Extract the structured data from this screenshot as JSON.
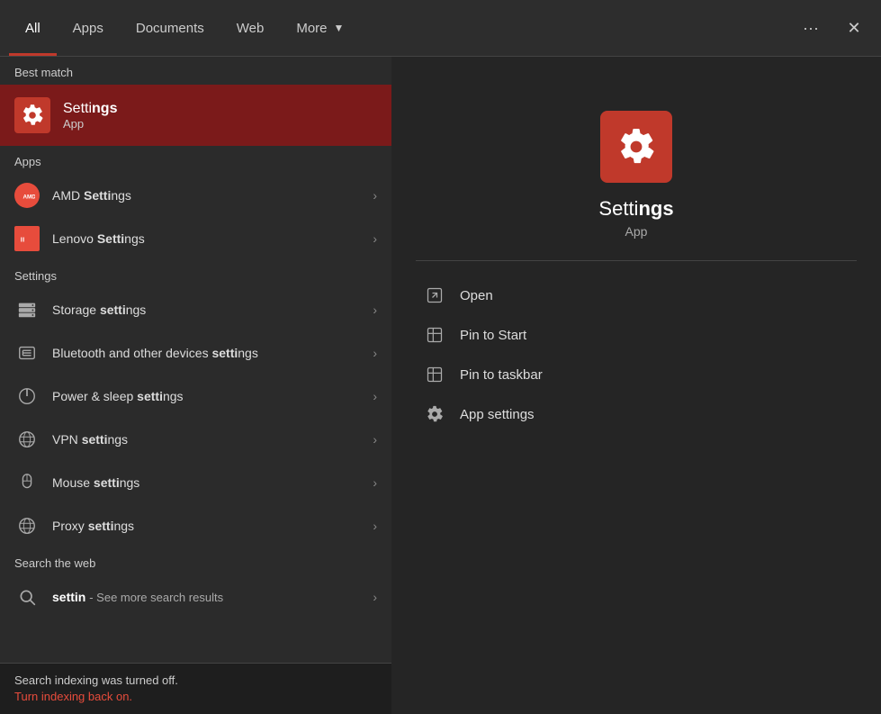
{
  "tabs": [
    {
      "id": "all",
      "label": "All",
      "active": true
    },
    {
      "id": "apps",
      "label": "Apps",
      "active": false
    },
    {
      "id": "documents",
      "label": "Documents",
      "active": false
    },
    {
      "id": "web",
      "label": "Web",
      "active": false
    },
    {
      "id": "more",
      "label": "More",
      "active": false,
      "has_dropdown": true
    }
  ],
  "actions": {
    "more_dots": "···",
    "close": "✕"
  },
  "best_match": {
    "section_label": "Best match",
    "title_prefix": "Setti",
    "title_bold": "ngs",
    "subtitle": "App"
  },
  "apps_section": {
    "label": "Apps",
    "items": [
      {
        "id": "amd",
        "prefix": "AMD ",
        "bold": "Setti",
        "suffix": "ngs"
      },
      {
        "id": "lenovo",
        "prefix": "Lenovo ",
        "bold": "Setti",
        "suffix": "ngs"
      }
    ]
  },
  "settings_section": {
    "label": "Settings",
    "items": [
      {
        "id": "storage",
        "prefix": "Storage ",
        "bold": "setti",
        "suffix": "ngs"
      },
      {
        "id": "bluetooth",
        "prefix": "Bluetooth and other devices ",
        "bold": "setti",
        "suffix": "ngs"
      },
      {
        "id": "power",
        "prefix": "Power & sleep ",
        "bold": "setti",
        "suffix": "ngs"
      },
      {
        "id": "vpn",
        "prefix": "VPN ",
        "bold": "setti",
        "suffix": "ngs"
      },
      {
        "id": "mouse",
        "prefix": "Mouse ",
        "bold": "setti",
        "suffix": "ngs"
      },
      {
        "id": "proxy",
        "prefix": "Proxy ",
        "bold": "setti",
        "suffix": "ngs"
      }
    ]
  },
  "search_web": {
    "label": "Search the web",
    "query": "settin",
    "sub_text": "- See more search results"
  },
  "bottom_bar": {
    "text": "Search indexing was turned off.",
    "link": "Turn indexing back on."
  },
  "right_panel": {
    "app_name_prefix": "Setti",
    "app_name_bold": "ngs",
    "app_type": "App",
    "actions": [
      {
        "id": "open",
        "label": "Open"
      },
      {
        "id": "pin_start",
        "label": "Pin to Start"
      },
      {
        "id": "pin_taskbar",
        "label": "Pin to taskbar"
      },
      {
        "id": "app_settings",
        "label": "App settings"
      }
    ]
  },
  "icons": {
    "chevron": "›",
    "search": "🔍",
    "open": "⬡",
    "pin": "📌",
    "gear": "⚙"
  }
}
